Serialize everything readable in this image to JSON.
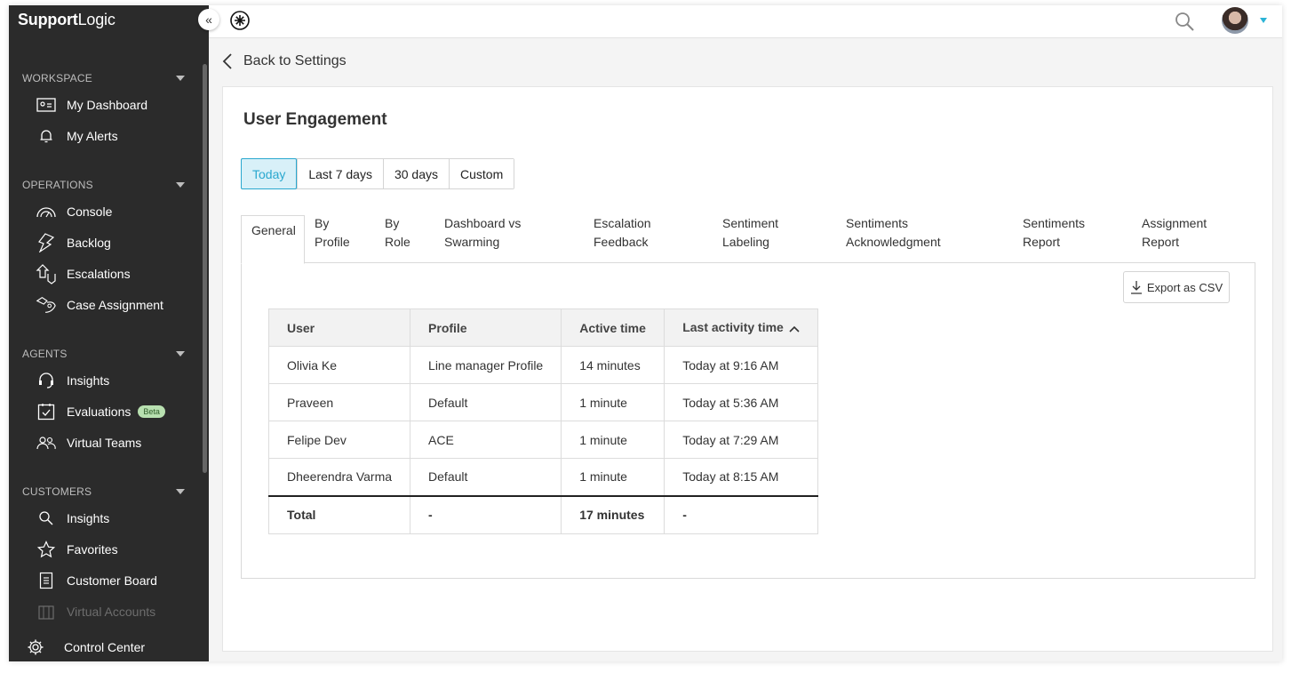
{
  "app": {
    "logo_bold": "Support",
    "logo_light": "Logic"
  },
  "sidebar": {
    "collapse_label": "«",
    "sections": [
      {
        "title": "WORKSPACE",
        "items": [
          {
            "label": "My Dashboard",
            "icon": "id-card-icon"
          },
          {
            "label": "My Alerts",
            "icon": "bell-icon"
          }
        ]
      },
      {
        "title": "OPERATIONS",
        "items": [
          {
            "label": "Console",
            "icon": "gauge-icon"
          },
          {
            "label": "Backlog",
            "icon": "lightning-icon"
          },
          {
            "label": "Escalations",
            "icon": "escalation-arrow-icon"
          },
          {
            "label": "Case Assignment",
            "icon": "case-assignment-icon"
          }
        ]
      },
      {
        "title": "AGENTS",
        "items": [
          {
            "label": "Insights",
            "icon": "headset-icon"
          },
          {
            "label": "Evaluations",
            "icon": "checklist-icon",
            "badge": "Beta"
          },
          {
            "label": "Virtual Teams",
            "icon": "people-icon"
          }
        ]
      },
      {
        "title": "CUSTOMERS",
        "items": [
          {
            "label": "Insights",
            "icon": "search-icon"
          },
          {
            "label": "Favorites",
            "icon": "star-icon"
          },
          {
            "label": "Customer Board",
            "icon": "document-icon"
          },
          {
            "label": "Virtual Accounts",
            "icon": "building-icon",
            "disabled": true
          }
        ]
      }
    ],
    "footer": {
      "label": "Control Center",
      "icon": "gear-icon"
    }
  },
  "topbar": {
    "app_icon": "app-asterisk-icon",
    "search_icon": "search-icon",
    "avatar": "user-avatar"
  },
  "back": {
    "label": "Back to Settings"
  },
  "page": {
    "title": "User Engagement",
    "ranges": [
      "Today",
      "Last 7 days",
      "30 days",
      "Custom"
    ],
    "active_range": "Today",
    "tabs": [
      {
        "line1": "General",
        "line2": ""
      },
      {
        "line1": "By",
        "line2": "Profile"
      },
      {
        "line1": "By",
        "line2": "Role"
      },
      {
        "line1": "Dashboard vs",
        "line2": "Swarming"
      },
      {
        "line1": "Escalation",
        "line2": "Feedback"
      },
      {
        "line1": "Sentiment",
        "line2": "Labeling"
      },
      {
        "line1": "Sentiments",
        "line2": "Acknowledgment"
      },
      {
        "line1": "Sentiments",
        "line2": "Report"
      },
      {
        "line1": "Assignment",
        "line2": "Report"
      }
    ],
    "active_tab": "General",
    "export_label": "Export as CSV",
    "table": {
      "headers": [
        "User",
        "Profile",
        "Active time",
        "Last activity time"
      ],
      "sort_column": "Last activity time",
      "sort_direction": "ascending",
      "rows": [
        [
          "Olivia Ke",
          "Line manager Profile",
          "14 minutes",
          "Today at 9:16 AM"
        ],
        [
          "Praveen",
          "Default",
          "1 minute",
          "Today at 5:36 AM"
        ],
        [
          "Felipe Dev",
          "ACE",
          "1 minute",
          "Today at 7:29 AM"
        ],
        [
          "Dheerendra Varma",
          "Default",
          "1 minute",
          "Today at 8:15 AM"
        ]
      ],
      "total": [
        "Total",
        "-",
        "17 minutes",
        "-"
      ]
    }
  },
  "colors": {
    "sidebar_bg": "#2b2b2b",
    "accent": "#2aa8cf",
    "active_range_bg": "#d8f0f8",
    "beta_badge_bg": "#b8e0b0"
  }
}
